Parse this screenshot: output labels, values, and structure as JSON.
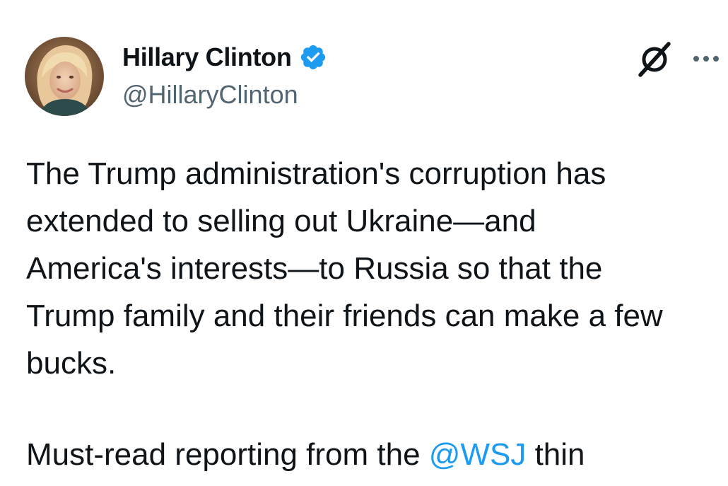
{
  "author": {
    "display_name": "Hillary Clinton",
    "handle": "@HillaryClinton",
    "verified_color": "#1d9bf0"
  },
  "actions": {
    "grok_icon": "grok-icon",
    "more_icon": "more-icon"
  },
  "post": {
    "lines": [
      "The Trump administration's corruption has",
      "extended to selling out Ukraine—and",
      "America's interests—to Russia so that the",
      "Trump family and their friends can make a few",
      "bucks."
    ],
    "second_para_prefix": "Must-read reporting from the ",
    "mention": "@WSJ",
    "second_para_suffix": " thin"
  },
  "colors": {
    "text": "#0f1419",
    "secondary": "#536471",
    "link": "#1d9bf0"
  }
}
